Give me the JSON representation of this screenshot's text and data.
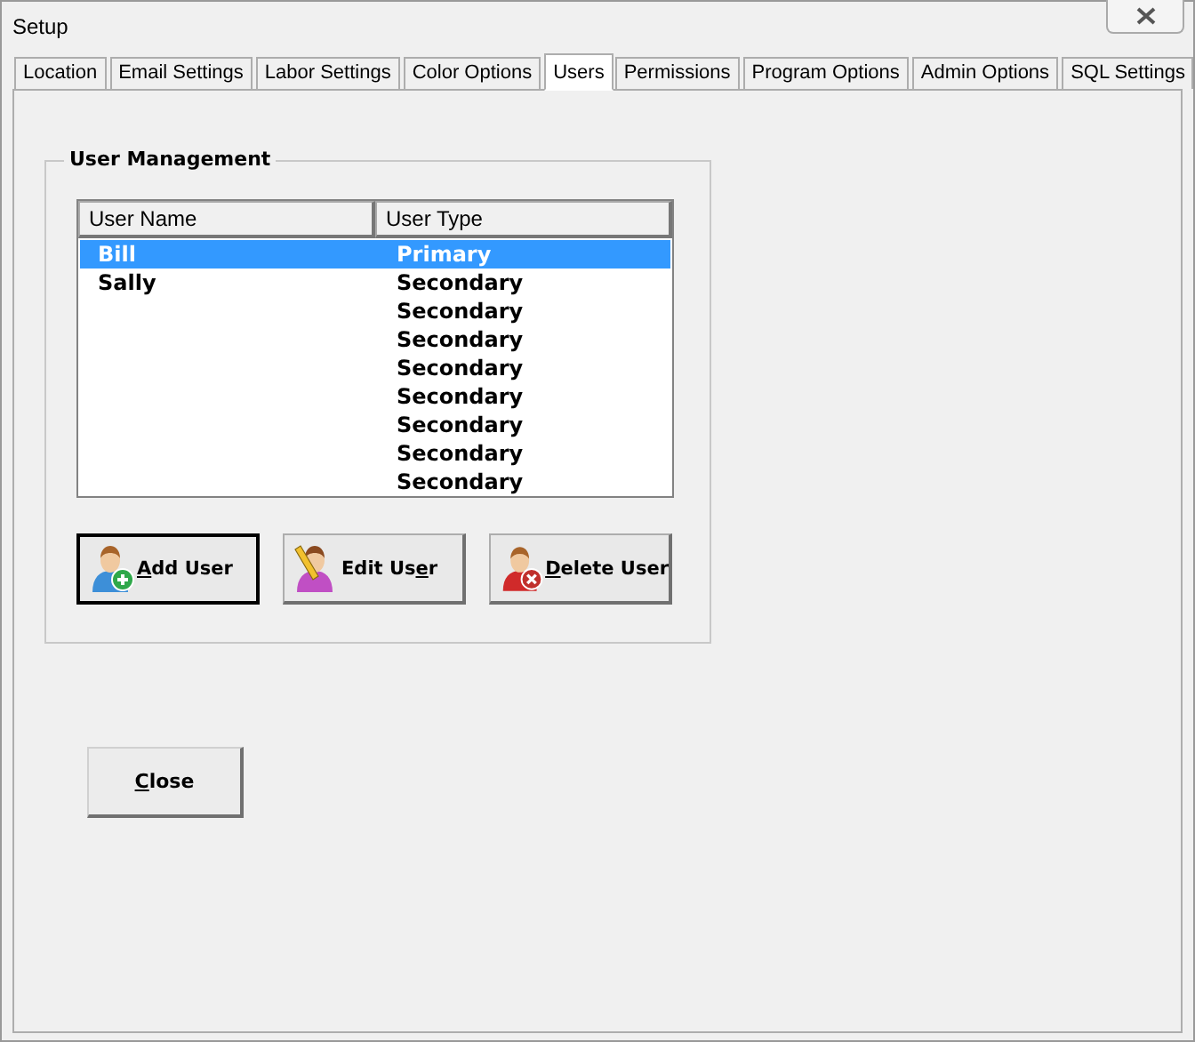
{
  "window": {
    "title": "Setup"
  },
  "tabs": [
    {
      "label": "Location",
      "selected": false
    },
    {
      "label": "Email Settings",
      "selected": false
    },
    {
      "label": "Labor Settings",
      "selected": false
    },
    {
      "label": "Color Options",
      "selected": false
    },
    {
      "label": "Users",
      "selected": true
    },
    {
      "label": "Permissions",
      "selected": false
    },
    {
      "label": "Program Options",
      "selected": false
    },
    {
      "label": "Admin Options",
      "selected": false
    },
    {
      "label": "SQL Settings",
      "selected": false
    }
  ],
  "group": {
    "title": "User Management",
    "table": {
      "columns": [
        "User Name",
        "User Type"
      ],
      "rows": [
        {
          "name": "Bill",
          "type": "Primary",
          "selected": true
        },
        {
          "name": "Sally",
          "type": "Secondary",
          "selected": false
        },
        {
          "type": "Secondary",
          "selected": false
        },
        {
          "type": "Secondary",
          "selected": false
        },
        {
          "type": "Secondary",
          "selected": false
        },
        {
          "type": "Secondary",
          "selected": false
        },
        {
          "type": "Secondary",
          "selected": false
        },
        {
          "type": "Secondary",
          "selected": false
        },
        {
          "type": "Secondary",
          "selected": false
        }
      ]
    },
    "buttons": [
      {
        "access_key": "A",
        "label_rest": "dd User",
        "kind": "add",
        "focused": true
      },
      {
        "label_start": "Edit Us",
        "access_key": "e",
        "label_rest": "r",
        "kind": "edit",
        "focused": false
      },
      {
        "access_key": "D",
        "label_rest": "elete User",
        "kind": "delete",
        "focused": false
      }
    ]
  },
  "close_button": {
    "access_key": "C",
    "label_rest": "lose"
  }
}
